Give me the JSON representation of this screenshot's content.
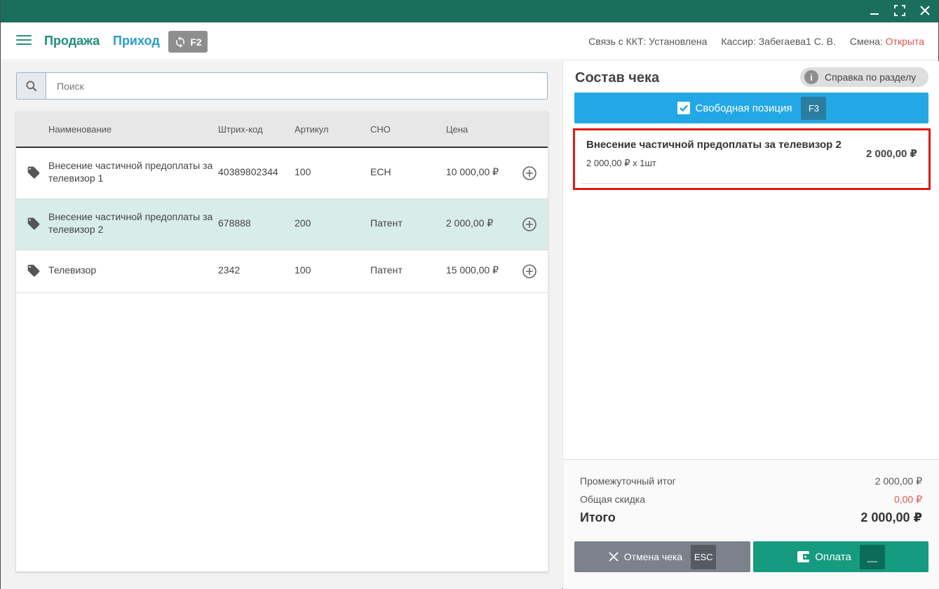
{
  "header": {
    "sale_tab": "Продажа",
    "income_tab": "Приход",
    "switch_key": "F2",
    "kkt_label": "Связь с ККТ:",
    "kkt_status": "Установлена",
    "cashier_label": "Кассир:",
    "cashier_name": "Забегаева1 С. В.",
    "shift_label": "Смена:",
    "shift_status": "Открыта"
  },
  "search": {
    "placeholder": "Поиск"
  },
  "table": {
    "columns": {
      "name": "Наименование",
      "barcode": "Штрих-код",
      "article": "Артикул",
      "tax": "СНО",
      "price": "Цена"
    },
    "rows": [
      {
        "name": "Внесение частичной предоплаты за телевизор 1",
        "barcode": "40389802344",
        "article": "100",
        "tax": "ЕСН",
        "price": "10 000,00 ₽"
      },
      {
        "name": "Внесение частичной предоплаты за телевизор 2",
        "barcode": "678888",
        "article": "200",
        "tax": "Патент",
        "price": "2 000,00 ₽"
      },
      {
        "name": "Телевизор",
        "barcode": "2342",
        "article": "100",
        "tax": "Патент",
        "price": "15 000,00 ₽"
      }
    ]
  },
  "receipt": {
    "title": "Состав чека",
    "help": "Справка по разделу",
    "free_position": "Свободная позиция",
    "free_key": "F3",
    "item": {
      "name": "Внесение частичной предоплаты за телевизор 2",
      "qty": "2 000,00 ₽ x 1шт",
      "price": "2 000,00 ₽"
    },
    "subtotal_label": "Промежуточный итог",
    "subtotal": "2 000,00 ₽",
    "discount_label": "Общая скидка",
    "discount": "0,00 ₽",
    "total_label": "Итого",
    "total": "2 000,00 ₽",
    "cancel": "Отмена чека",
    "cancel_key": "ESC",
    "pay": "Оплата",
    "pay_key": "__"
  },
  "colors": {
    "titlebar": "#1a6e5c",
    "sale": "#1d8e79",
    "income": "#2b9ccc",
    "free_btn": "#23a8e6",
    "pay_btn": "#159b80",
    "cancel_btn": "#7c828c",
    "highlight": "#e01919",
    "shift_open": "#e05252"
  }
}
